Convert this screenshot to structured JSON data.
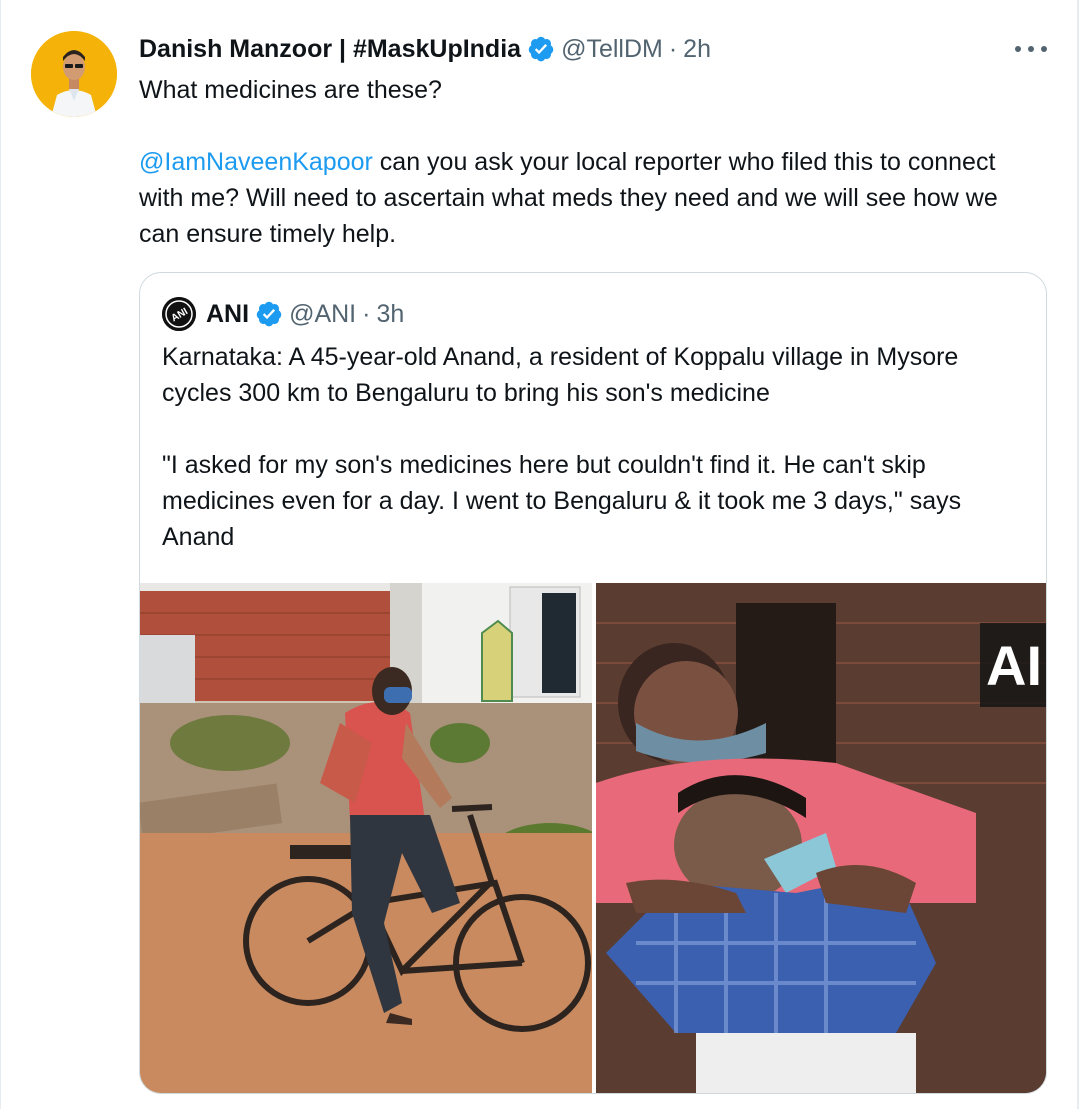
{
  "tweet": {
    "author_name": "Danish Manzoor | #MaskUpIndia",
    "handle": "@TellDM",
    "separator": "·",
    "time": "2h",
    "line1": "What medicines are these?",
    "mention": "@IamNaveenKapoor",
    "line2_rest": " can you ask your local reporter who filed this to connect with me? Will need to ascertain what meds they need and we will see how we can ensure timely help."
  },
  "quote": {
    "logo_text": "ANI",
    "author_name": "ANI",
    "handle": "@ANI",
    "separator": "·",
    "time": "3h",
    "para1": "Karnataka: A 45-year-old Anand, a resident of Koppalu village in Mysore cycles 300 km to Bengaluru to bring his son's medicine",
    "para2": "\"I asked for my son's medicines here but couldn't find it. He can't skip medicines even for a day. I went to Bengaluru & it took me 3 days,\" says Anand",
    "watermark": "AI"
  },
  "icons": {
    "verified": "verified-badge-icon",
    "more": "more-horizontal-icon"
  },
  "colors": {
    "accent": "#1d9bf0",
    "text": "#0f1419",
    "secondary": "#536471",
    "border": "#cfd9de"
  }
}
